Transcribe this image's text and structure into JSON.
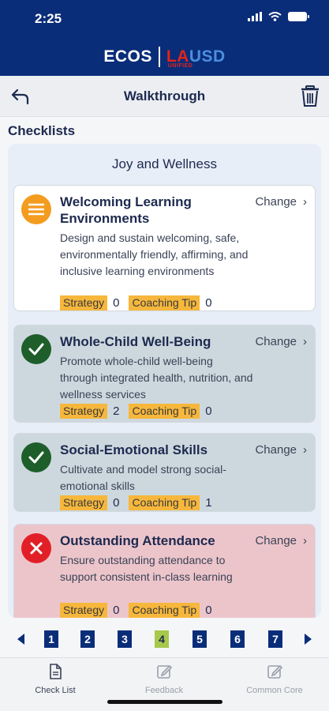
{
  "status": {
    "time": "2:25"
  },
  "brand": {
    "left": "ECOS",
    "la": "LA",
    "usd": "USD",
    "unified": "UNIFIED"
  },
  "nav": {
    "title": "Walkthrough"
  },
  "section_title": "Checklists",
  "panel_title": "Joy and Wellness",
  "change_label": "Change",
  "strategy_label": "Strategy",
  "coaching_label": "Coaching Tip",
  "cards": [
    {
      "title": "Welcoming Learning Environments",
      "description": "Design and sustain welcoming, safe, environmentally friendly, affirming, and inclusive learning environments",
      "strategy": "0",
      "coaching": "0",
      "status": "neutral"
    },
    {
      "title": "Whole-Child Well-Being",
      "description": "Promote whole-child well-being through integrated health, nutrition, and wellness services",
      "strategy": "2",
      "coaching": "0",
      "status": "done"
    },
    {
      "title": "Social-Emotional Skills",
      "description": "Cultivate and model strong social-emotional skills",
      "strategy": "0",
      "coaching": "1",
      "status": "done"
    },
    {
      "title": "Outstanding Attendance",
      "description": "Ensure outstanding attendance to support consistent in-class learning",
      "strategy": "0",
      "coaching": "0",
      "status": "fail"
    }
  ],
  "pager": {
    "pages": [
      "1",
      "2",
      "3",
      "4",
      "5",
      "6",
      "7"
    ],
    "active": "4"
  },
  "tabs": [
    {
      "label": "Check List",
      "icon": "document-icon"
    },
    {
      "label": "Feedback",
      "icon": "edit-icon"
    },
    {
      "label": "Common Core",
      "icon": "edit-icon"
    }
  ],
  "colors": {
    "header": "#0a2d79",
    "neutral": "#f39c1f",
    "done": "#1e5e2a",
    "fail": "#e21f26",
    "tag": "#f6b73c",
    "active_page": "#a7c84a"
  }
}
